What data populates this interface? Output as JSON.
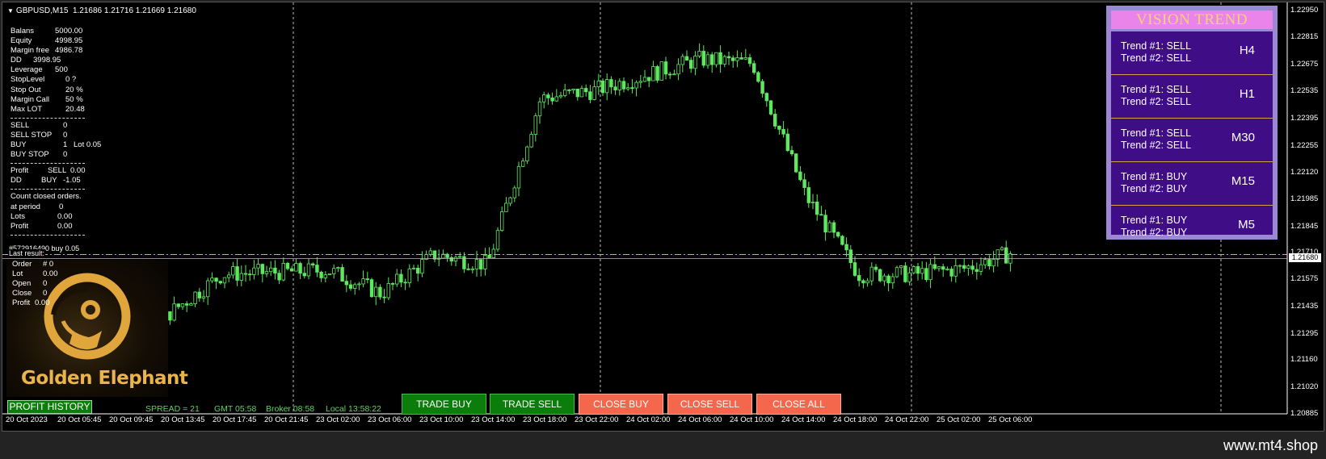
{
  "header": {
    "symbol": "GBPUSD,M15",
    "ohlc": "1.21686 1.21716 1.21669 1.21680"
  },
  "account": [
    {
      "label": "Balans",
      "value": "5000.00"
    },
    {
      "label": "Equity",
      "value": "4998.95"
    },
    {
      "label": "Margin free",
      "value": "4986.78"
    },
    {
      "label": "DD",
      "value": "3998.95"
    },
    {
      "label": "Leverage",
      "value": "500"
    },
    {
      "label": "StopLevel",
      "value": "0 ?"
    },
    {
      "label": "Stop Out",
      "value": "20 %"
    },
    {
      "label": "Margin Call",
      "value": "50 %"
    },
    {
      "label": "Max LOT",
      "value": "20.48"
    }
  ],
  "orders": [
    {
      "label": "SELL",
      "value": "0",
      "extra": ""
    },
    {
      "label": "SELL STOP",
      "value": "0",
      "extra": ""
    },
    {
      "label": "BUY",
      "value": "1",
      "extra": "Lot  0.05"
    },
    {
      "label": "BUY STOP",
      "value": "0",
      "extra": ""
    }
  ],
  "profit": [
    {
      "label": "Profit",
      "side": "SELL",
      "value": "0.00"
    },
    {
      "label": "DD",
      "side": "BUY",
      "value": "-1.05"
    }
  ],
  "closed": {
    "title": "Count closed orders.",
    "rows": [
      {
        "label": "at period",
        "value": "0"
      },
      {
        "label": "Lots",
        "value": "0.00"
      },
      {
        "label": "Profit",
        "value": "0.00"
      }
    ]
  },
  "order_line_label": "#572916490 buy 0.05",
  "last_result_label": "Last result:",
  "last_result": [
    {
      "label": "Order",
      "value": "# 0"
    },
    {
      "label": "Lot",
      "value": "0.00"
    },
    {
      "label": "Open",
      "value": "0"
    },
    {
      "label": "Close",
      "value": "0"
    },
    {
      "label": "Profit",
      "value": "0.00"
    }
  ],
  "logo_text": "Golden Elephant",
  "buttons": {
    "history": "PROFIT HISTORY",
    "trade_buy": "TRADE BUY",
    "trade_sell": "TRADE SELL",
    "close_buy": "CLOSE BUY",
    "close_sell": "CLOSE SELL",
    "close_all": "CLOSE ALL"
  },
  "status": {
    "spread": "SPREAD = 21",
    "gmt": "GMT 05:58",
    "broker": "Broker 08:58",
    "local": "Local 13:58:22"
  },
  "time_labels": [
    "20 Oct 2023",
    "20 Oct 05:45",
    "20 Oct 09:45",
    "20 Oct 13:45",
    "20 Oct 17:45",
    "20 Oct 21:45",
    "23 Oct 02:00",
    "23 Oct 06:00",
    "23 Oct 10:00",
    "23 Oct 14:00",
    "23 Oct 18:00",
    "23 Oct 22:00",
    "24 Oct 02:00",
    "24 Oct 06:00",
    "24 Oct 10:00",
    "24 Oct 14:00",
    "24 Oct 18:00",
    "24 Oct 22:00",
    "25 Oct 02:00",
    "25 Oct 06:00"
  ],
  "price_labels": [
    "1.22950",
    "1.22815",
    "1.22675",
    "1.22535",
    "1.22395",
    "1.22255",
    "1.22120",
    "1.21985",
    "1.21845",
    "1.21710",
    "1.21575",
    "1.21435",
    "1.21295",
    "1.21160",
    "1.21020",
    "1.20885"
  ],
  "current_price": "1.21680",
  "panel": {
    "title": "VISION TREND",
    "rows": [
      {
        "t1": "Trend #1: SELL",
        "t2": "Trend #2: SELL",
        "tf": "H4"
      },
      {
        "t1": "Trend #1: SELL",
        "t2": "Trend #2: SELL",
        "tf": "H1"
      },
      {
        "t1": "Trend #1: SELL",
        "t2": "Trend #2: SELL",
        "tf": "M30"
      },
      {
        "t1": "Trend #1: BUY",
        "t2": "Trend #2: BUY",
        "tf": "M15"
      },
      {
        "t1": "Trend #1: BUY",
        "t2": "Trend #2: BUY",
        "tf": "M5"
      }
    ]
  },
  "watermark": "www.mt4.shop",
  "colors": {
    "candle": "#5ee85e",
    "buy_button": "#0a7d0a",
    "close_button": "#f4674d",
    "panel_bg": "#3f0e87",
    "panel_frame": "#9b87d4"
  },
  "chart_data": {
    "type": "candlestick",
    "symbol": "GBPUSD",
    "timeframe": "M15",
    "ylim": [
      1.20885,
      1.2295
    ],
    "points": [
      {
        "t": "20 Oct 2023",
        "price": 1.2142
      },
      {
        "t": "20 Oct 05:45",
        "price": 1.2128
      },
      {
        "t": "20 Oct 09:45",
        "price": 1.2108
      },
      {
        "t": "20 Oct 13:45",
        "price": 1.214
      },
      {
        "t": "20 Oct 17:45",
        "price": 1.216
      },
      {
        "t": "20 Oct 21:45",
        "price": 1.2161
      },
      {
        "t": "23 Oct 02:00",
        "price": 1.2162
      },
      {
        "t": "23 Oct 06:00",
        "price": 1.215
      },
      {
        "t": "23 Oct 10:00",
        "price": 1.217
      },
      {
        "t": "23 Oct 14:00",
        "price": 1.2165
      },
      {
        "t": "23 Oct 18:00",
        "price": 1.225
      },
      {
        "t": "23 Oct 22:00",
        "price": 1.2254
      },
      {
        "t": "24 Oct 02:00",
        "price": 1.2262
      },
      {
        "t": "24 Oct 06:00",
        "price": 1.227
      },
      {
        "t": "24 Oct 10:00",
        "price": 1.2268
      },
      {
        "t": "24 Oct 14:00",
        "price": 1.22
      },
      {
        "t": "24 Oct 18:00",
        "price": 1.216
      },
      {
        "t": "24 Oct 22:00",
        "price": 1.216
      },
      {
        "t": "25 Oct 02:00",
        "price": 1.2163
      },
      {
        "t": "25 Oct 06:00",
        "price": 1.2172
      }
    ]
  }
}
